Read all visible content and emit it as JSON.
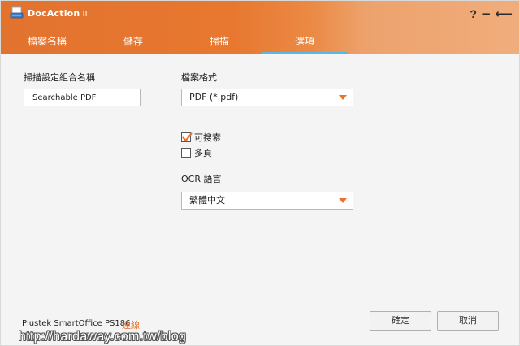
{
  "app": {
    "title": "DocAction",
    "version": "II"
  },
  "window_controls": {
    "help": "?",
    "minimize": "−",
    "back": "⟵"
  },
  "tabs": [
    {
      "label": "檔案名稱",
      "active": false
    },
    {
      "label": "儲存",
      "active": false
    },
    {
      "label": "掃描",
      "active": false
    },
    {
      "label": "選項",
      "active": true
    }
  ],
  "options": {
    "profile_name_label": "掃描設定組合名稱",
    "profile_name_value": "Searchable PDF",
    "file_format_label": "檔案格式",
    "file_format_value": "PDF (*.pdf)",
    "searchable_label": "可搜索",
    "searchable_checked": true,
    "multipage_label": "多頁",
    "multipage_checked": false,
    "ocr_label": "OCR 語言",
    "ocr_value": "繁體中文"
  },
  "footer": {
    "model": "Plustek SmartOffice PS186",
    "connection_link": "連線",
    "ok_label": "確定",
    "cancel_label": "取消"
  },
  "watermark": "http://hardaway.com.tw/blog",
  "colors": {
    "accent": "#e8732e",
    "tab_indicator": "#56b9e6",
    "background": "#f4f4f4"
  }
}
